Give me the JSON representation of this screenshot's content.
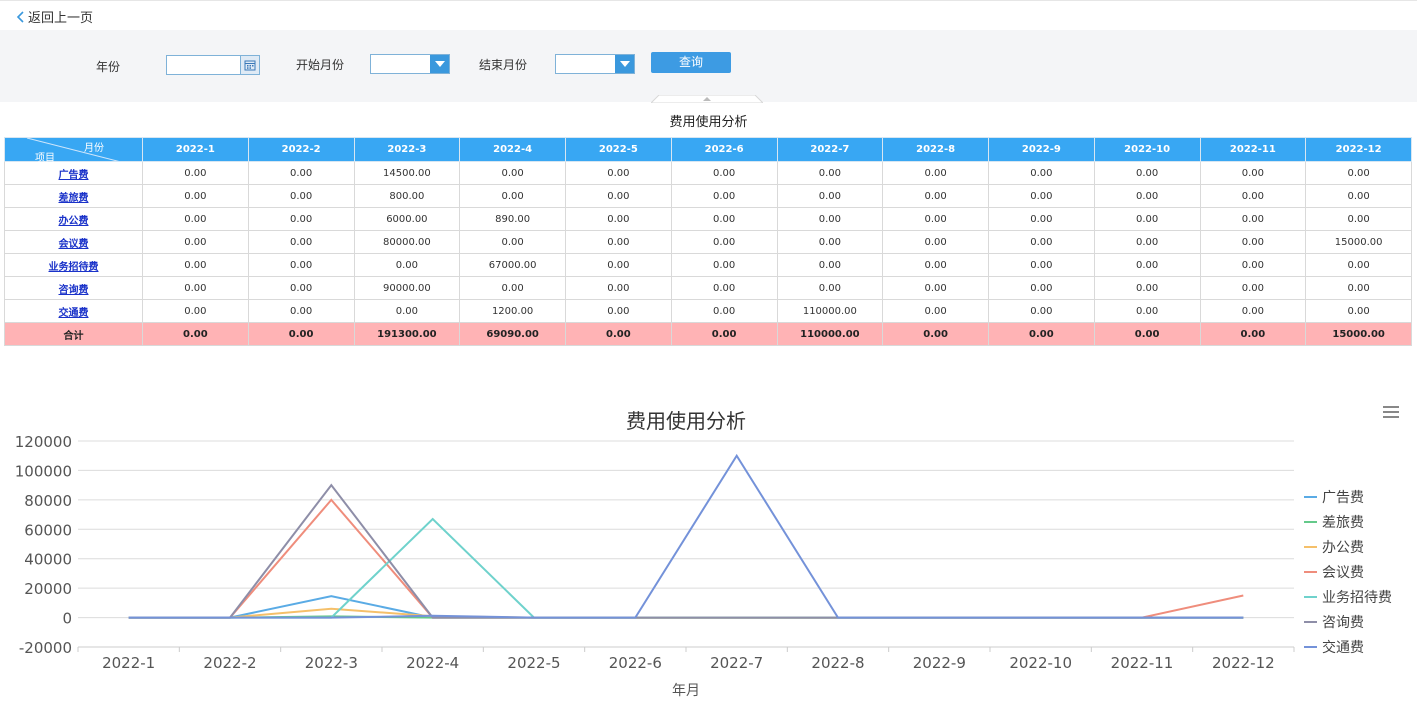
{
  "nav": {
    "back_label": "返回上一页"
  },
  "filter": {
    "year_label": "年份",
    "start_month_label": "开始月份",
    "end_month_label": "结束月份",
    "year_value": "",
    "start_month_value": "",
    "end_month_value": "",
    "query_label": "查询"
  },
  "table": {
    "title": "费用使用分析",
    "corner_month": "月份",
    "corner_item": "项目",
    "columns": [
      "2022-1",
      "2022-2",
      "2022-3",
      "2022-4",
      "2022-5",
      "2022-6",
      "2022-7",
      "2022-8",
      "2022-9",
      "2022-10",
      "2022-11",
      "2022-12"
    ],
    "rows": [
      {
        "name": "广告费",
        "values": [
          "0.00",
          "0.00",
          "14500.00",
          "0.00",
          "0.00",
          "0.00",
          "0.00",
          "0.00",
          "0.00",
          "0.00",
          "0.00",
          "0.00"
        ]
      },
      {
        "name": "差旅费",
        "values": [
          "0.00",
          "0.00",
          "800.00",
          "0.00",
          "0.00",
          "0.00",
          "0.00",
          "0.00",
          "0.00",
          "0.00",
          "0.00",
          "0.00"
        ]
      },
      {
        "name": "办公费",
        "values": [
          "0.00",
          "0.00",
          "6000.00",
          "890.00",
          "0.00",
          "0.00",
          "0.00",
          "0.00",
          "0.00",
          "0.00",
          "0.00",
          "0.00"
        ]
      },
      {
        "name": "会议费",
        "values": [
          "0.00",
          "0.00",
          "80000.00",
          "0.00",
          "0.00",
          "0.00",
          "0.00",
          "0.00",
          "0.00",
          "0.00",
          "0.00",
          "15000.00"
        ]
      },
      {
        "name": "业务招待费",
        "values": [
          "0.00",
          "0.00",
          "0.00",
          "67000.00",
          "0.00",
          "0.00",
          "0.00",
          "0.00",
          "0.00",
          "0.00",
          "0.00",
          "0.00"
        ]
      },
      {
        "name": "咨询费",
        "values": [
          "0.00",
          "0.00",
          "90000.00",
          "0.00",
          "0.00",
          "0.00",
          "0.00",
          "0.00",
          "0.00",
          "0.00",
          "0.00",
          "0.00"
        ]
      },
      {
        "name": "交通费",
        "values": [
          "0.00",
          "0.00",
          "0.00",
          "1200.00",
          "0.00",
          "0.00",
          "110000.00",
          "0.00",
          "0.00",
          "0.00",
          "0.00",
          "0.00"
        ]
      }
    ],
    "total": {
      "name": "合计",
      "values": [
        "0.00",
        "0.00",
        "191300.00",
        "69090.00",
        "0.00",
        "0.00",
        "110000.00",
        "0.00",
        "0.00",
        "0.00",
        "0.00",
        "15000.00"
      ]
    }
  },
  "chart_data": {
    "type": "line",
    "title": "费用使用分析",
    "xlabel": "年月",
    "ylabel": "",
    "categories": [
      "2022-1",
      "2022-2",
      "2022-3",
      "2022-4",
      "2022-5",
      "2022-6",
      "2022-7",
      "2022-8",
      "2022-9",
      "2022-10",
      "2022-11",
      "2022-12"
    ],
    "ylim": [
      -20000,
      120000
    ],
    "yticks": [
      120000,
      100000,
      80000,
      60000,
      40000,
      20000,
      0,
      -20000
    ],
    "grid": true,
    "legend_position": "right",
    "series": [
      {
        "name": "广告费",
        "color": "#5aabe5",
        "values": [
          0,
          0,
          14500,
          0,
          0,
          0,
          0,
          0,
          0,
          0,
          0,
          0
        ]
      },
      {
        "name": "差旅费",
        "color": "#64c98a",
        "values": [
          0,
          0,
          800,
          0,
          0,
          0,
          0,
          0,
          0,
          0,
          0,
          0
        ]
      },
      {
        "name": "办公费",
        "color": "#f5c06a",
        "values": [
          0,
          0,
          6000,
          890,
          0,
          0,
          0,
          0,
          0,
          0,
          0,
          0
        ]
      },
      {
        "name": "会议费",
        "color": "#ef8d7c",
        "values": [
          0,
          0,
          80000,
          0,
          0,
          0,
          0,
          0,
          0,
          0,
          0,
          15000
        ]
      },
      {
        "name": "业务招待费",
        "color": "#6fd2cc",
        "values": [
          0,
          0,
          0,
          67000,
          0,
          0,
          0,
          0,
          0,
          0,
          0,
          0
        ]
      },
      {
        "name": "咨询费",
        "color": "#8e8ea8",
        "values": [
          0,
          0,
          90000,
          0,
          0,
          0,
          0,
          0,
          0,
          0,
          0,
          0
        ]
      },
      {
        "name": "交通费",
        "color": "#7492d9",
        "values": [
          0,
          0,
          0,
          1200,
          0,
          0,
          110000,
          0,
          0,
          0,
          0,
          0
        ]
      }
    ]
  },
  "icons": {
    "back": "chevron-left-icon",
    "calendar": "calendar-icon",
    "dropdown": "chevron-down-icon",
    "chart_menu": "hamburger-menu-icon"
  }
}
